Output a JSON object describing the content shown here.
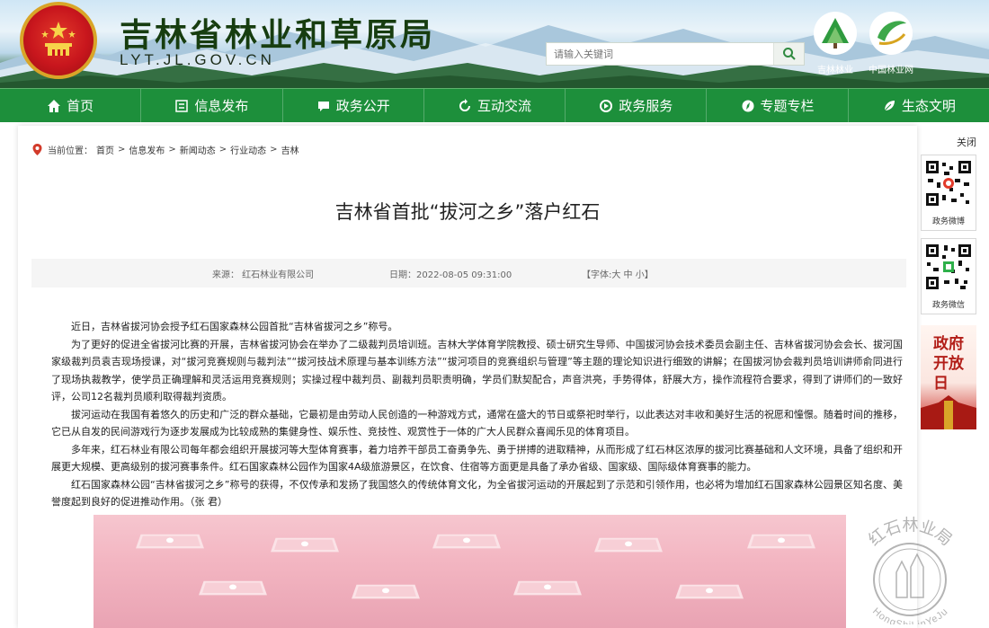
{
  "header": {
    "title": "吉林省林业和草原局",
    "domain": "LYT.JL.GOV.CN",
    "search_placeholder": "请输入关键词",
    "logos": [
      "吉林林业",
      "中国林业网"
    ]
  },
  "nav": {
    "items": [
      {
        "label": "首页",
        "icon": "home-icon"
      },
      {
        "label": "信息发布",
        "icon": "document-icon"
      },
      {
        "label": "政务公开",
        "icon": "chat-icon"
      },
      {
        "label": "互动交流",
        "icon": "refresh-icon"
      },
      {
        "label": "政务服务",
        "icon": "service-icon"
      },
      {
        "label": "专题专栏",
        "icon": "compass-icon"
      },
      {
        "label": "生态文明",
        "icon": "leaf-icon"
      }
    ]
  },
  "breadcrumb": {
    "prefix": "当前位置：",
    "items": [
      "首页",
      "信息发布",
      "新闻动态",
      "行业动态",
      "吉林"
    ]
  },
  "article": {
    "title": "吉林省首批“拔河之乡”落户红石",
    "source": "来源：  红石林业有限公司",
    "date": "日期：2022-08-05 09:31:00",
    "font_size": "【字体:大 中 小】",
    "paragraphs": [
      "近日，吉林省拔河协会授予红石国家森林公园首批“吉林省拔河之乡”称号。",
      "为了更好的促进全省拔河比赛的开展，吉林省拔河协会在举办了二级裁判员培训班。吉林大学体育学院教授、硕士研究生导师、中国拔河协会技术委员会副主任、吉林省拔河协会会长、拔河国家级裁判员袁吉现场授课，对“拔河竞赛规则与裁判法”“拔河技战术原理与基本训练方法”“拔河项目的竞赛组织与管理”等主题的理论知识进行细致的讲解；在国拔河协会裁判员培训讲师俞同进行了现场执裁教学，使学员正确理解和灵活运用竞赛规则；实操过程中裁判员、副裁判员职责明确，学员们默契配合，声音洪亮，手势得体，舒展大方，操作流程符合要求，得到了讲师们的一致好评，公司12名裁判员顺利取得裁判资质。",
      "拔河运动在我国有着悠久的历史和广泛的群众基础，它最初是由劳动人民创造的一种游戏方式，通常在盛大的节日或祭祀时举行，以此表达对丰收和美好生活的祝愿和憧憬。随着时间的推移，它已从自发的民间游戏行为逐步发展成为比较成熟的集健身性、娱乐性、竞技性、观赏性于一体的广大人民群众喜闻乐见的体育项目。",
      "多年来，红石林业有限公司每年都会组织开展拔河等大型体育赛事，着力培养干部员工奋勇争先、勇于拼搏的进取精神，从而形成了红石林区浓厚的拔河比赛基础和人文环境，具备了组织和开展更大规模、更高级别的拔河赛事条件。红石国家森林公园作为国家4A级旅游景区，在饮食、住宿等方面更是具备了承办省级、国家级、国际级体育赛事的能力。",
      "红石国家森林公园“吉林省拔河之乡”称号的获得，不仅传承和发扬了我国悠久的传统体育文化，为全省拔河运动的开展起到了示范和引领作用，也必将为增加红石国家森林公园景区知名度、美誉度起到良好的促进推动作用。（张 君）"
    ]
  },
  "sidebar": {
    "close_label": "关闭",
    "qr_cards": [
      {
        "label": "政务微博"
      },
      {
        "label": "政务微信"
      }
    ],
    "promo_text": "政府开放日"
  },
  "watermark": {
    "top_text": "红石林业局",
    "bottom_text": "HongShiLinYeJu"
  },
  "colors": {
    "nav_green": "#1d8f3b",
    "title_green": "#173d10",
    "promo_red": "#b21e18"
  }
}
